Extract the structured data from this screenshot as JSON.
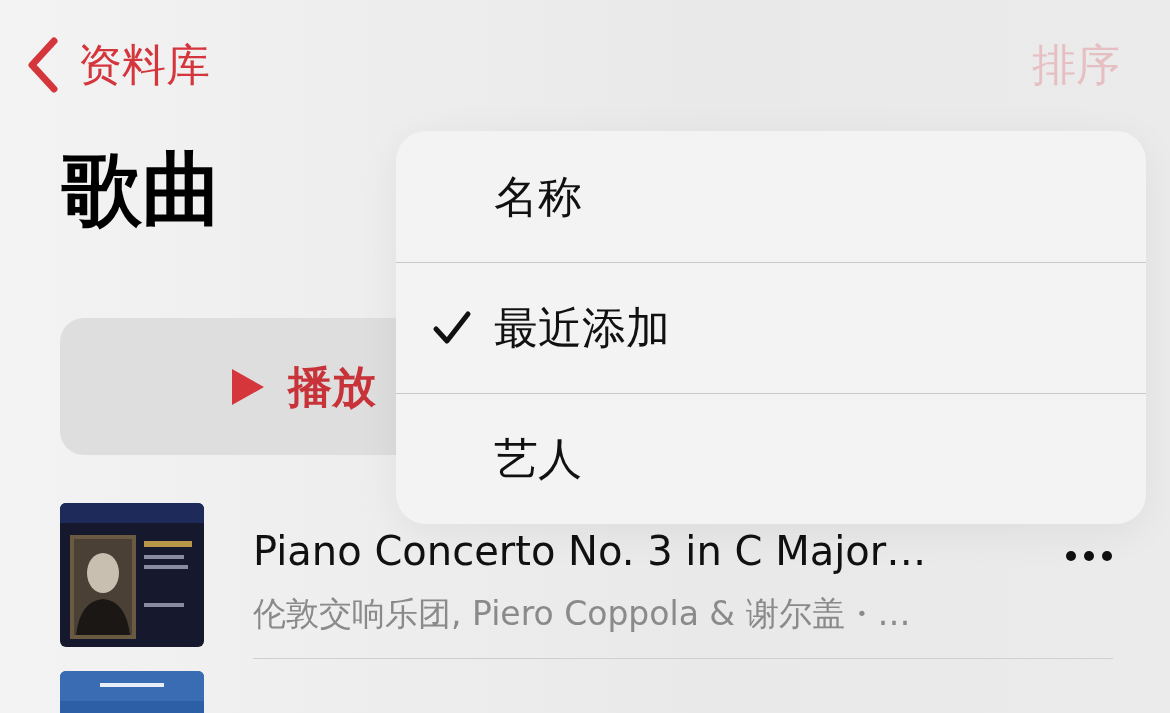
{
  "nav": {
    "back_label": "资料库",
    "sort_label": "排序"
  },
  "title": "歌曲",
  "play_button": {
    "label": "播放"
  },
  "sort_menu": [
    {
      "label": "名称",
      "selected": false
    },
    {
      "label": "最近添加",
      "selected": true
    },
    {
      "label": "艺人",
      "selected": false
    }
  ],
  "songs": [
    {
      "kind": "picture",
      "title": "Piano Concerto No. 3 in C Major…",
      "subtitle": "伦敦交响乐团, Piero Coppola & 谢尔盖・…"
    },
    {
      "kind": "picture"
    }
  ]
}
